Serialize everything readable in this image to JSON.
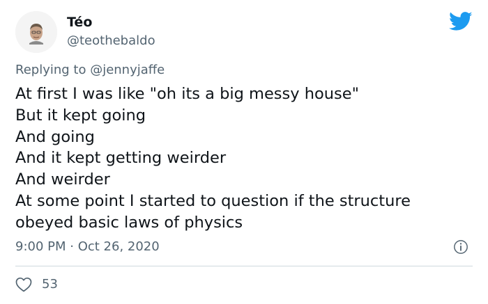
{
  "author": {
    "display_name": "Téo",
    "handle": "@teothebaldo",
    "avatar_icon": "person-avatar",
    "brand_icon": "twitter-bird-icon",
    "brand_color": "#1d9bf0"
  },
  "reply": {
    "prefix": "Replying to ",
    "mention": "@jennyjaffe"
  },
  "body": {
    "lines": [
      "At first I was like \"oh its a big messy house\"",
      "But it kept going",
      "And going",
      "And it kept getting weirder",
      "And weirder",
      "At some point I started to question if the structure",
      "obeyed basic laws of physics"
    ]
  },
  "meta": {
    "time": "9:00 PM",
    "separator": " · ",
    "date": "Oct 26, 2020",
    "info_icon": "info-icon"
  },
  "actions": {
    "like_icon": "heart-icon",
    "like_count": "53"
  }
}
